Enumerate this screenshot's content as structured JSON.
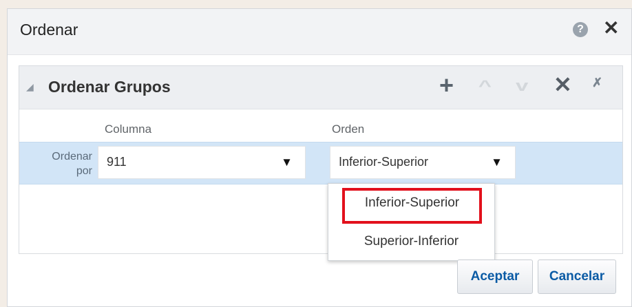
{
  "dialog": {
    "title": "Ordenar",
    "help_icon": "question-circle-icon",
    "close_icon": "close-icon",
    "help_glyph": "?",
    "close_glyph": "✕"
  },
  "panel": {
    "title": "Ordenar Grupos",
    "toolbar_icons": [
      "plus-icon",
      "arrow-up-icon",
      "arrow-down-icon",
      "delete-icon",
      "delete-all-icon"
    ],
    "columns": {
      "column": "Columna",
      "order": "Orden"
    },
    "rows": [
      {
        "label": "Ordenar por",
        "column_value": "911",
        "order_value": "Inferior-Superior"
      }
    ]
  },
  "dropdown": {
    "options": [
      "Inferior-Superior",
      "Superior-Inferior"
    ],
    "highlighted": "Inferior-Superior"
  },
  "buttons": {
    "accept": "Aceptar",
    "cancel": "Cancelar"
  },
  "colors": {
    "selected_row": "#d2e5f7",
    "highlight_border": "#e2101c",
    "button_text": "#0b5ba5"
  }
}
